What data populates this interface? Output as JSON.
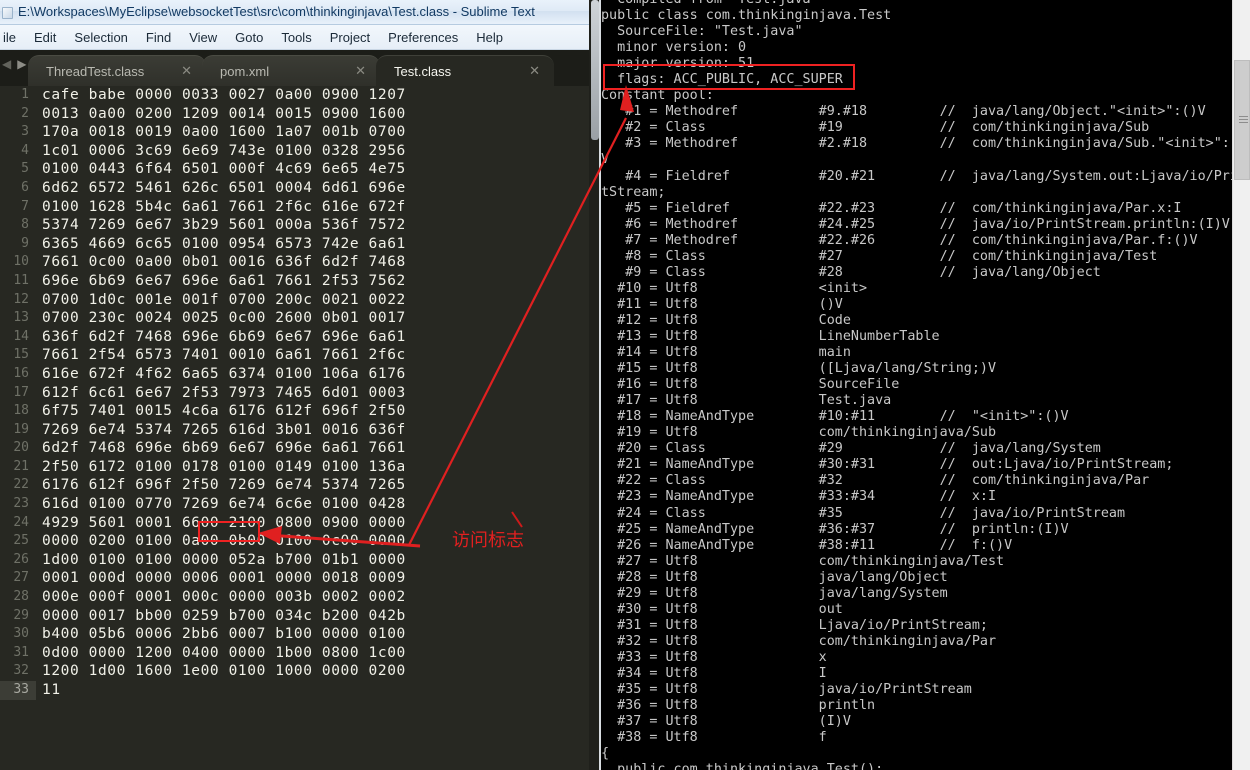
{
  "window": {
    "title": "E:\\Workspaces\\MyEclipse\\websocketTest\\src\\com\\thinkinginjava\\Test.class - Sublime Text",
    "sysicon": "window-system-icon"
  },
  "menubar": {
    "items": [
      "ile",
      "Edit",
      "Selection",
      "Find",
      "View",
      "Goto",
      "Tools",
      "Project",
      "Preferences",
      "Help"
    ]
  },
  "tabbar": {
    "nav_prev": "◀",
    "nav_next": "▶",
    "close_glyph": "✕",
    "tabs": [
      {
        "label": "ThreadTest.class",
        "active": false
      },
      {
        "label": "pom.xml",
        "active": false
      },
      {
        "label": "Test.class",
        "active": true
      }
    ]
  },
  "editor": {
    "current_line": 33,
    "lines": [
      {
        "n": 1,
        "text": "cafe babe 0000 0033 0027 0a00 0900 1207"
      },
      {
        "n": 2,
        "text": "0013 0a00 0200 1209 0014 0015 0900 1600"
      },
      {
        "n": 3,
        "text": "170a 0018 0019 0a00 1600 1a07 001b 0700"
      },
      {
        "n": 4,
        "text": "1c01 0006 3c69 6e69 743e 0100 0328 2956"
      },
      {
        "n": 5,
        "text": "0100 0443 6f64 6501 000f 4c69 6e65 4e75"
      },
      {
        "n": 6,
        "text": "6d62 6572 5461 626c 6501 0004 6d61 696e"
      },
      {
        "n": 7,
        "text": "0100 1628 5b4c 6a61 7661 2f6c 616e 672f"
      },
      {
        "n": 8,
        "text": "5374 7269 6e67 3b29 5601 000a 536f 7572"
      },
      {
        "n": 9,
        "text": "6365 4669 6c65 0100 0954 6573 742e 6a61"
      },
      {
        "n": 10,
        "text": "7661 0c00 0a00 0b01 0016 636f 6d2f 7468"
      },
      {
        "n": 11,
        "text": "696e 6b69 6e67 696e 6a61 7661 2f53 7562"
      },
      {
        "n": 12,
        "text": "0700 1d0c 001e 001f 0700 200c 0021 0022"
      },
      {
        "n": 13,
        "text": "0700 230c 0024 0025 0c00 2600 0b01 0017"
      },
      {
        "n": 14,
        "text": "636f 6d2f 7468 696e 6b69 6e67 696e 6a61"
      },
      {
        "n": 15,
        "text": "7661 2f54 6573 7401 0010 6a61 7661 2f6c"
      },
      {
        "n": 16,
        "text": "616e 672f 4f62 6a65 6374 0100 106a 6176"
      },
      {
        "n": 17,
        "text": "612f 6c61 6e67 2f53 7973 7465 6d01 0003"
      },
      {
        "n": 18,
        "text": "6f75 7401 0015 4c6a 6176 612f 696f 2f50"
      },
      {
        "n": 19,
        "text": "7269 6e74 5374 7265 616d 3b01 0016 636f"
      },
      {
        "n": 20,
        "text": "6d2f 7468 696e 6b69 6e67 696e 6a61 7661"
      },
      {
        "n": 21,
        "text": "2f50 6172 0100 0178 0100 0149 0100 136a"
      },
      {
        "n": 22,
        "text": "6176 612f 696f 2f50 7269 6e74 5374 7265"
      },
      {
        "n": 23,
        "text": "616d 0100 0770 7269 6e74 6c6e 0100 0428"
      },
      {
        "n": 24,
        "text": "4929 5601 0001 6600 2100 0800 0900 0000"
      },
      {
        "n": 25,
        "text": "0000 0200 0100 0a00 0b00 0100 0c00 0000"
      },
      {
        "n": 26,
        "text": "1d00 0100 0100 0000 052a b700 01b1 0000"
      },
      {
        "n": 27,
        "text": "0001 000d 0000 0006 0001 0000 0018 0009"
      },
      {
        "n": 28,
        "text": "000e 000f 0001 000c 0000 003b 0002 0002"
      },
      {
        "n": 29,
        "text": "0000 0017 bb00 0259 b700 034c b200 042b"
      },
      {
        "n": 30,
        "text": "b400 05b6 0006 2bb6 0007 b100 0000 0100"
      },
      {
        "n": 31,
        "text": "0d00 0000 1200 0400 0000 1b00 0800 1c00"
      },
      {
        "n": 32,
        "text": "1200 1d00 1600 1e00 0100 1000 0000 0200"
      },
      {
        "n": 33,
        "text": "11"
      }
    ]
  },
  "console": {
    "lines": [
      "  Compiled from \"Test.java\"",
      "public class com.thinkinginjava.Test",
      "  SourceFile: \"Test.java\"",
      "  minor version: 0",
      "  major version: 51",
      "  flags: ACC_PUBLIC, ACC_SUPER",
      "Constant pool:",
      "   #1 = Methodref          #9.#18         //  java/lang/Object.\"<init>\":()V",
      "   #2 = Class              #19            //  com/thinkinginjava/Sub",
      "   #3 = Methodref          #2.#18         //  com/thinkinginjava/Sub.\"<init>\":()",
      "V",
      "   #4 = Fieldref           #20.#21        //  java/lang/System.out:Ljava/io/Prin",
      "tStream;",
      "   #5 = Fieldref           #22.#23        //  com/thinkinginjava/Par.x:I",
      "   #6 = Methodref          #24.#25        //  java/io/PrintStream.println:(I)V",
      "   #7 = Methodref          #22.#26        //  com/thinkinginjava/Par.f:()V",
      "   #8 = Class              #27            //  com/thinkinginjava/Test",
      "   #9 = Class              #28            //  java/lang/Object",
      "  #10 = Utf8               <init>",
      "  #11 = Utf8               ()V",
      "  #12 = Utf8               Code",
      "  #13 = Utf8               LineNumberTable",
      "  #14 = Utf8               main",
      "  #15 = Utf8               ([Ljava/lang/String;)V",
      "  #16 = Utf8               SourceFile",
      "  #17 = Utf8               Test.java",
      "  #18 = NameAndType        #10:#11        //  \"<init>\":()V",
      "  #19 = Utf8               com/thinkinginjava/Sub",
      "  #20 = Class              #29            //  java/lang/System",
      "  #21 = NameAndType        #30:#31        //  out:Ljava/io/PrintStream;",
      "  #22 = Class              #32            //  com/thinkinginjava/Par",
      "  #23 = NameAndType        #33:#34        //  x:I",
      "  #24 = Class              #35            //  java/io/PrintStream",
      "  #25 = NameAndType        #36:#37        //  println:(I)V",
      "  #26 = NameAndType        #38:#11        //  f:()V",
      "  #27 = Utf8               com/thinkinginjava/Test",
      "  #28 = Utf8               java/lang/Object",
      "  #29 = Utf8               java/lang/System",
      "  #30 = Utf8               out",
      "  #31 = Utf8               Ljava/io/PrintStream;",
      "  #32 = Utf8               com/thinkinginjava/Par",
      "  #33 = Utf8               x",
      "  #34 = Utf8               I",
      "  #35 = Utf8               java/io/PrintStream",
      "  #36 = Utf8               println",
      "  #37 = Utf8               (I)V",
      "  #38 = Utf8               f",
      "{",
      "  public com.thinkinginjava.Test();"
    ]
  },
  "annotations": {
    "label": "访问标志",
    "highlight_color": "#ef2222",
    "flags_highlight_target": "flags: ACC_PUBLIC, ACC_SUPER",
    "hex_highlight_target": "00 21"
  }
}
